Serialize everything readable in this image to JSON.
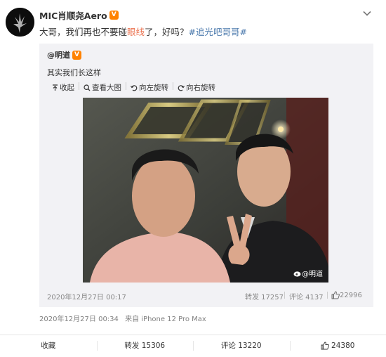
{
  "post": {
    "author": "MIC肖顺尧Aero",
    "badge": "V",
    "text_prefix": "大哥，我们再也不要碰",
    "text_highlight": "眼线",
    "text_suffix": "了，好吗？",
    "hashtag": "#追光吧哥哥#",
    "time": "2020年12月27日 00:34",
    "source": "来自 iPhone 12 Pro Max"
  },
  "quote": {
    "author": "@明道",
    "badge": "V",
    "text": "其实我们长这样",
    "toolbar": [
      "收起",
      "查看大图",
      "向左旋转",
      "向右旋转"
    ],
    "watermark": "@明道",
    "time": "2020年12月27日 00:17",
    "repost": "转发 17257",
    "comment": "评论 4137",
    "likes": "22996"
  },
  "actions": {
    "favorite": "收藏",
    "repost": "转发 15306",
    "comment": "评论 13220",
    "likes": "24380"
  },
  "colors": {
    "badge": "#ff8200",
    "highlight": "#eb7350",
    "hashtag": "#507daf",
    "quote_bg": "#f2f2f5"
  },
  "icons": [
    "chevron-down-icon",
    "collapse-icon",
    "zoom-icon",
    "rotate-left-icon",
    "rotate-right-icon",
    "thumbs-up-icon",
    "weibo-icon"
  ]
}
